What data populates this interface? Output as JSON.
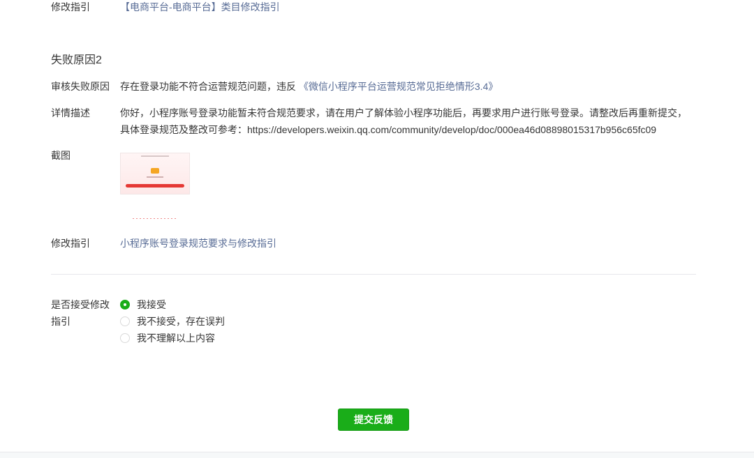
{
  "prev_section": {
    "guide_label": "修改指引",
    "guide_link": "【电商平台-电商平台】类目修改指引"
  },
  "reason2": {
    "title": "失败原因2",
    "fail_label": "审核失败原因",
    "fail_text": "存在登录功能不符合运营规范问题，违反",
    "fail_link": "《微信小程序平台运营规范常见拒绝情形3.4》",
    "detail_label": "详情描述",
    "detail_line1": "你好，小程序账号登录功能暂未符合规范要求，请在用户了解体验小程序功能后，再要求用户进行账号登录。请整改后再重新提交，",
    "detail_line2": "具体登录规范及整改可参考：https://developers.weixin.qq.com/community/develop/doc/000ea46d08898015317b956c65fc09",
    "screenshot_label": "截图",
    "guide_label": "修改指引",
    "guide_link": "小程序账号登录规范要求与修改指引"
  },
  "accept": {
    "label_line1": "是否接受修改",
    "label_line2": "指引",
    "options": [
      {
        "label": "我接受",
        "checked": true
      },
      {
        "label": "我不接受，存在误判",
        "checked": false
      },
      {
        "label": "我不理解以上内容",
        "checked": false
      }
    ]
  },
  "submit_label": "提交反馈",
  "colors": {
    "accent": "#1aad19",
    "link": "#576b95",
    "text": "#353535",
    "divider": "#e7e7eb"
  }
}
